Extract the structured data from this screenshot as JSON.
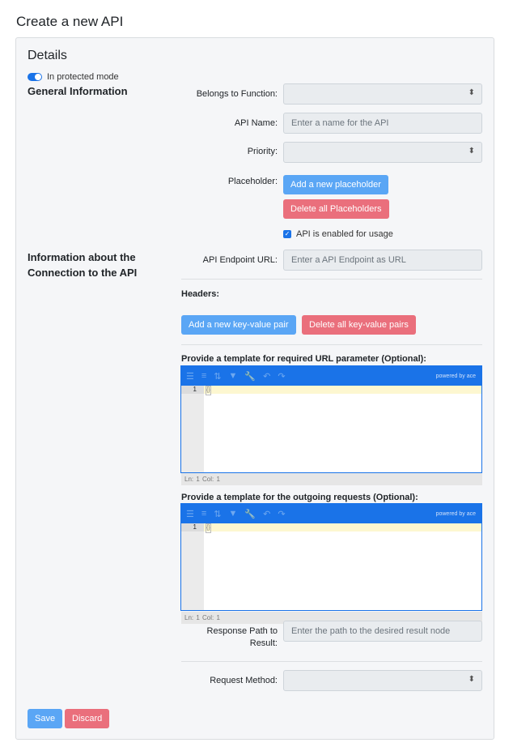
{
  "page_title": "Create a new API",
  "card_title": "Details",
  "protected_mode": {
    "label": "In protected mode",
    "on": true
  },
  "sections": {
    "general": "General Information",
    "connection": "Information about the Connection to the API"
  },
  "fields": {
    "function_label": "Belongs to Function:",
    "api_name_label": "API Name:",
    "api_name_placeholder": "Enter a name for the API",
    "priority_label": "Priority:",
    "placeholder_label": "Placeholder:",
    "add_placeholder": "Add a new placeholder",
    "delete_placeholders": "Delete all Placeholders",
    "enabled_label": "API is enabled for usage",
    "enabled": true,
    "endpoint_label": "API Endpoint URL:",
    "endpoint_placeholder": "Enter a API Endpoint as URL",
    "headers_label": "Headers:",
    "add_kv": "Add a new key-value pair",
    "delete_kv": "Delete all key-value pairs",
    "url_template_label": "Provide a template for required URL parameter (Optional):",
    "request_template_label": "Provide a template for the outgoing requests (Optional):",
    "response_path_label": "Response Path to Result:",
    "response_path_placeholder": "Enter the path to the desired result node",
    "method_label": "Request Method:"
  },
  "editor": {
    "powered": "powered by ace",
    "line_no": "1",
    "content": "{}",
    "status": "Ln: 1    Col: 1"
  },
  "actions": {
    "save": "Save",
    "discard": "Discard"
  }
}
